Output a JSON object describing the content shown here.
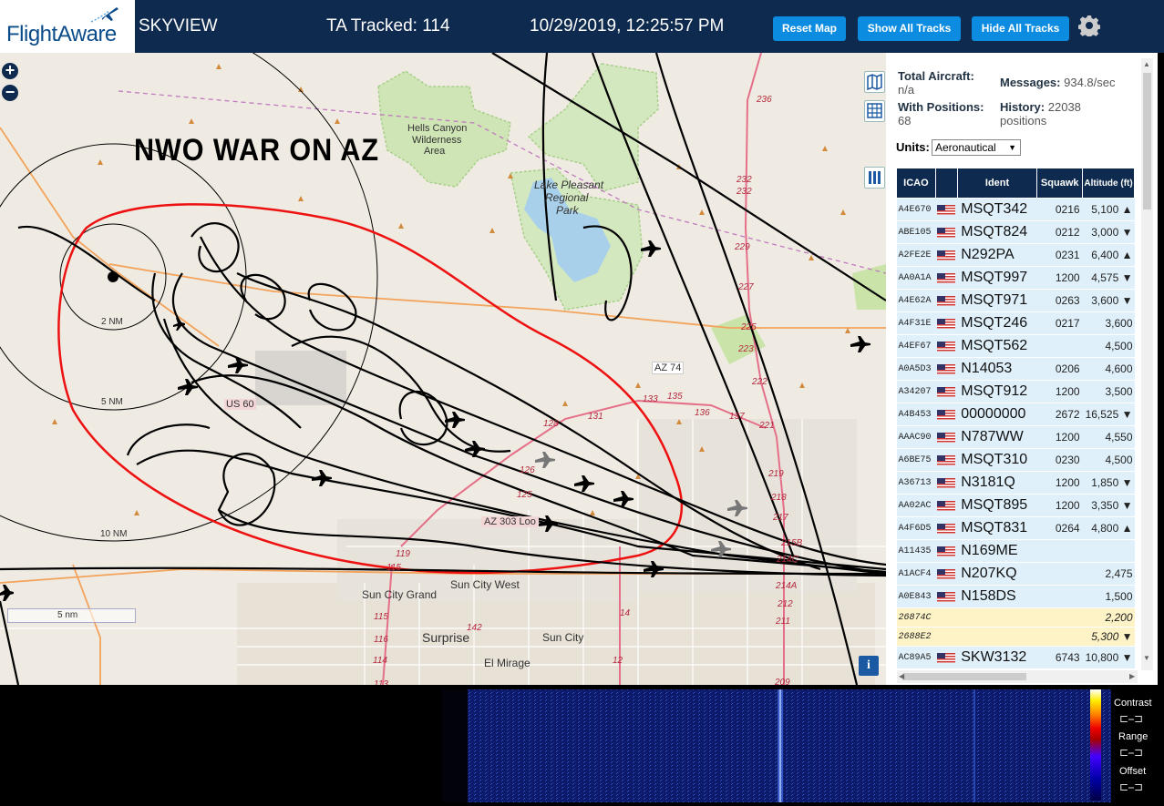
{
  "header": {
    "logo_text": "FlightAware",
    "app_name": "SKYVIEW",
    "tracked": "TA Tracked: 114",
    "datetime": "10/29/2019, 12:25:57 PM",
    "btn_reset": "Reset Map",
    "btn_show": "Show All Tracks",
    "btn_hide": "Hide All Tracks",
    "accent": "#0c8ce0",
    "bar_color": "#0e2a4e"
  },
  "map": {
    "overlay_text": "NWO WAR ON AZ",
    "labels": {
      "hells_canyon": "Hells Canyon",
      "wilderness": "Wilderness",
      "area": "Area",
      "lake_pleasant": "Lake Pleasant",
      "regional": "Regional",
      "park": "Park",
      "az74": "AZ 74",
      "us60": "US 60",
      "az303": "AZ 303 Loo",
      "sun_city_west": "Sun City West",
      "sun_city_grand": "Sun City Grand",
      "surprise": "Surprise",
      "sun_city": "Sun City",
      "el_mirage": "El Mirage",
      "nm2": "2 NM",
      "nm5": "5 NM",
      "nm10": "10 NM"
    },
    "road_numbers": [
      "236",
      "232",
      "232",
      "229",
      "227",
      "225",
      "223",
      "222",
      "221",
      "219",
      "218",
      "217",
      "215B",
      "214C",
      "214A",
      "212",
      "211",
      "209",
      "133",
      "135",
      "136",
      "137",
      "131",
      "128",
      "126",
      "125",
      "119",
      "115",
      "116",
      "115",
      "114",
      "113",
      "142",
      "14",
      "12"
    ],
    "scale": "5 nm",
    "info": "i"
  },
  "stats": {
    "total_label": "Total Aircraft:",
    "total_value": "n/a",
    "messages_label": "Messages:",
    "messages_value": "934.8/sec",
    "positions_label": "With Positions:",
    "positions_value": "68",
    "history_label": "History:",
    "history_value": "22038",
    "history_unit": "positions",
    "units_label": "Units:",
    "units_value": "Aeronautical"
  },
  "table": {
    "headers": [
      "ICAO",
      "",
      "Ident",
      "Squawk",
      "Altitude (ft)"
    ],
    "rows": [
      {
        "icao": "A4E670",
        "ident": "MSQT342",
        "squawk": "0216",
        "alt": "5,100 ▲",
        "flag": true
      },
      {
        "icao": "ABE105",
        "ident": "MSQT824",
        "squawk": "0212",
        "alt": "3,000 ▼",
        "flag": true
      },
      {
        "icao": "A2FE2E",
        "ident": "N292PA",
        "squawk": "0231",
        "alt": "6,400 ▲",
        "flag": true
      },
      {
        "icao": "AA0A1A",
        "ident": "MSQT997",
        "squawk": "1200",
        "alt": "4,575 ▼",
        "flag": true
      },
      {
        "icao": "A4E62A",
        "ident": "MSQT971",
        "squawk": "0263",
        "alt": "3,600 ▼",
        "flag": true
      },
      {
        "icao": "A4F31E",
        "ident": "MSQT246",
        "squawk": "0217",
        "alt": "3,600",
        "flag": true
      },
      {
        "icao": "A4EF67",
        "ident": "MSQT562",
        "squawk": "",
        "alt": "4,500",
        "flag": true
      },
      {
        "icao": "A0A5D3",
        "ident": "N14053",
        "squawk": "0206",
        "alt": "4,600",
        "flag": true
      },
      {
        "icao": "A34207",
        "ident": "MSQT912",
        "squawk": "1200",
        "alt": "3,500",
        "flag": true
      },
      {
        "icao": "A4B453",
        "ident": "00000000",
        "squawk": "2672",
        "alt": "16,525 ▼",
        "flag": true
      },
      {
        "icao": "AAAC90",
        "ident": "N787WW",
        "squawk": "1200",
        "alt": "4,550",
        "flag": true
      },
      {
        "icao": "A6BE75",
        "ident": "MSQT310",
        "squawk": "0230",
        "alt": "4,500",
        "flag": true
      },
      {
        "icao": "A36713",
        "ident": "N3181Q",
        "squawk": "1200",
        "alt": "1,850 ▼",
        "flag": true
      },
      {
        "icao": "AA02AC",
        "ident": "MSQT895",
        "squawk": "1200",
        "alt": "3,350 ▼",
        "flag": true
      },
      {
        "icao": "A4F6D5",
        "ident": "MSQT831",
        "squawk": "0264",
        "alt": "4,800 ▲",
        "flag": true
      },
      {
        "icao": "A11435",
        "ident": "N169ME",
        "squawk": "",
        "alt": "",
        "flag": true
      },
      {
        "icao": "A1ACF4",
        "ident": "N207KQ",
        "squawk": "",
        "alt": "2,475",
        "flag": true
      },
      {
        "icao": "A0E843",
        "ident": "N158DS",
        "squawk": "",
        "alt": "1,500",
        "flag": true
      },
      {
        "icao": "26874C",
        "ident": "",
        "squawk": "",
        "alt": "2,200",
        "flag": false
      },
      {
        "icao": "2688E2",
        "ident": "",
        "squawk": "",
        "alt": "5,300 ▼",
        "flag": false
      },
      {
        "icao": "AC89A5",
        "ident": "SKW3132",
        "squawk": "6743",
        "alt": "10,800 ▼",
        "flag": true
      }
    ]
  },
  "waterfall": {
    "contrast": "Contrast",
    "range": "Range",
    "offset": "Offset"
  }
}
